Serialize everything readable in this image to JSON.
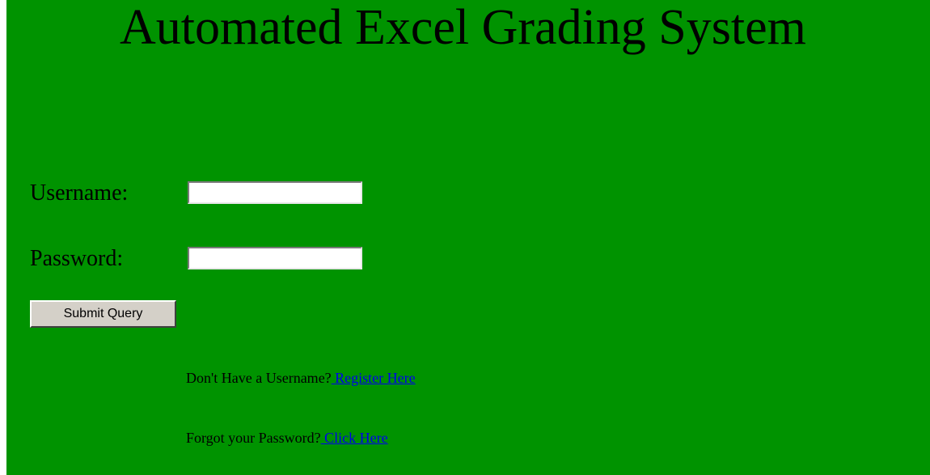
{
  "page": {
    "title": "Automated Excel Grading System",
    "background_color": "#009300",
    "link_color": "#0000ee"
  },
  "login_form": {
    "username_label": "Username:",
    "username_value": "",
    "password_label": "Password:",
    "password_value": "",
    "submit_label": "Submit Query"
  },
  "help": {
    "register_prompt": "Don't Have a Username?",
    "register_link": " Register Here",
    "forgot_prompt": "Forgot your Password?",
    "forgot_link": " Click Here"
  }
}
